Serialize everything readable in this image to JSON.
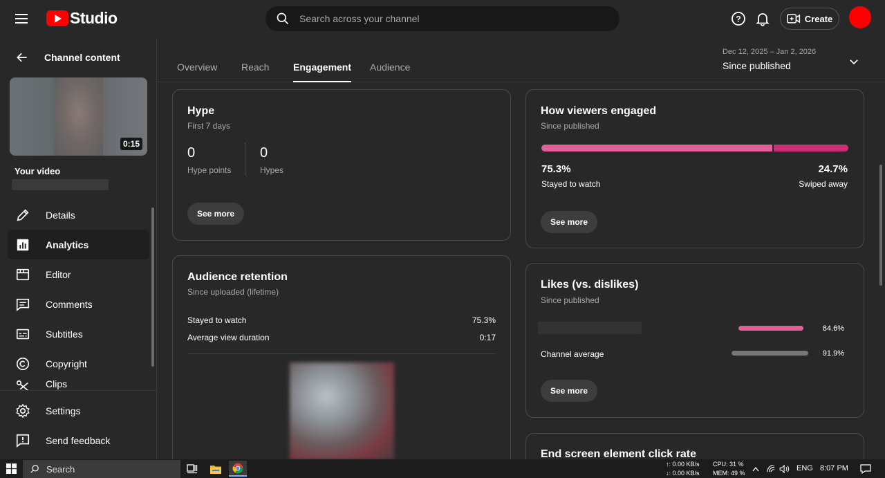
{
  "header": {
    "logo_text": "Studio",
    "search_placeholder": "Search across your channel",
    "create_label": "Create"
  },
  "sidebar": {
    "title": "Channel content",
    "video_duration": "0:15",
    "your_video_label": "Your video",
    "items": [
      {
        "label": "Details",
        "icon": "pencil-icon"
      },
      {
        "label": "Analytics",
        "icon": "analytics-icon",
        "active": true
      },
      {
        "label": "Editor",
        "icon": "editor-icon"
      },
      {
        "label": "Comments",
        "icon": "comments-icon"
      },
      {
        "label": "Subtitles",
        "icon": "subtitles-icon"
      },
      {
        "label": "Copyright",
        "icon": "copyright-icon"
      },
      {
        "label": "Clips",
        "icon": "scissors-icon"
      }
    ],
    "bottom_items": [
      {
        "label": "Settings",
        "icon": "gear-icon"
      },
      {
        "label": "Send feedback",
        "icon": "feedback-icon"
      }
    ]
  },
  "tabs": [
    "Overview",
    "Reach",
    "Engagement",
    "Audience"
  ],
  "active_tab": "Engagement",
  "date_range": {
    "range": "Dec 12, 2025 – Jan 2, 2026",
    "label": "Since published"
  },
  "hype": {
    "title": "Hype",
    "subtitle": "First 7 days",
    "hype_points_value": "0",
    "hype_points_label": "Hype points",
    "hypes_value": "0",
    "hypes_label": "Hypes",
    "see_more": "See more"
  },
  "engaged": {
    "title": "How viewers engaged",
    "subtitle": "Since published",
    "stayed_pct": "75.3%",
    "stayed_label": "Stayed to watch",
    "swiped_pct": "24.7%",
    "swiped_label": "Swiped away",
    "stayed_fraction": 0.753,
    "see_more": "See more"
  },
  "retention": {
    "title": "Audience retention",
    "subtitle": "Since uploaded (lifetime)",
    "stayed_label": "Stayed to watch",
    "stayed_value": "75.3%",
    "avd_label": "Average view duration",
    "avd_value": "0:17"
  },
  "likes": {
    "title": "Likes (vs. dislikes)",
    "subtitle": "Since published",
    "video_value": "84.6%",
    "video_fraction": 0.846,
    "channel_label": "Channel average",
    "channel_value": "91.9%",
    "channel_fraction": 0.919,
    "see_more": "See more"
  },
  "end_screen": {
    "title": "End screen element click rate"
  },
  "colors": {
    "accent_pink": "#e1609a",
    "swipe_pink": "#cc2f77",
    "neutral_bar": "#777777"
  },
  "taskbar": {
    "search_label": "Search",
    "net_up": "0.00 KB/s",
    "net_down": "0.00 KB/s",
    "cpu": "CPU: 31 %",
    "mem": "MEM: 49 %",
    "lang": "ENG",
    "time": "8:07 PM"
  }
}
